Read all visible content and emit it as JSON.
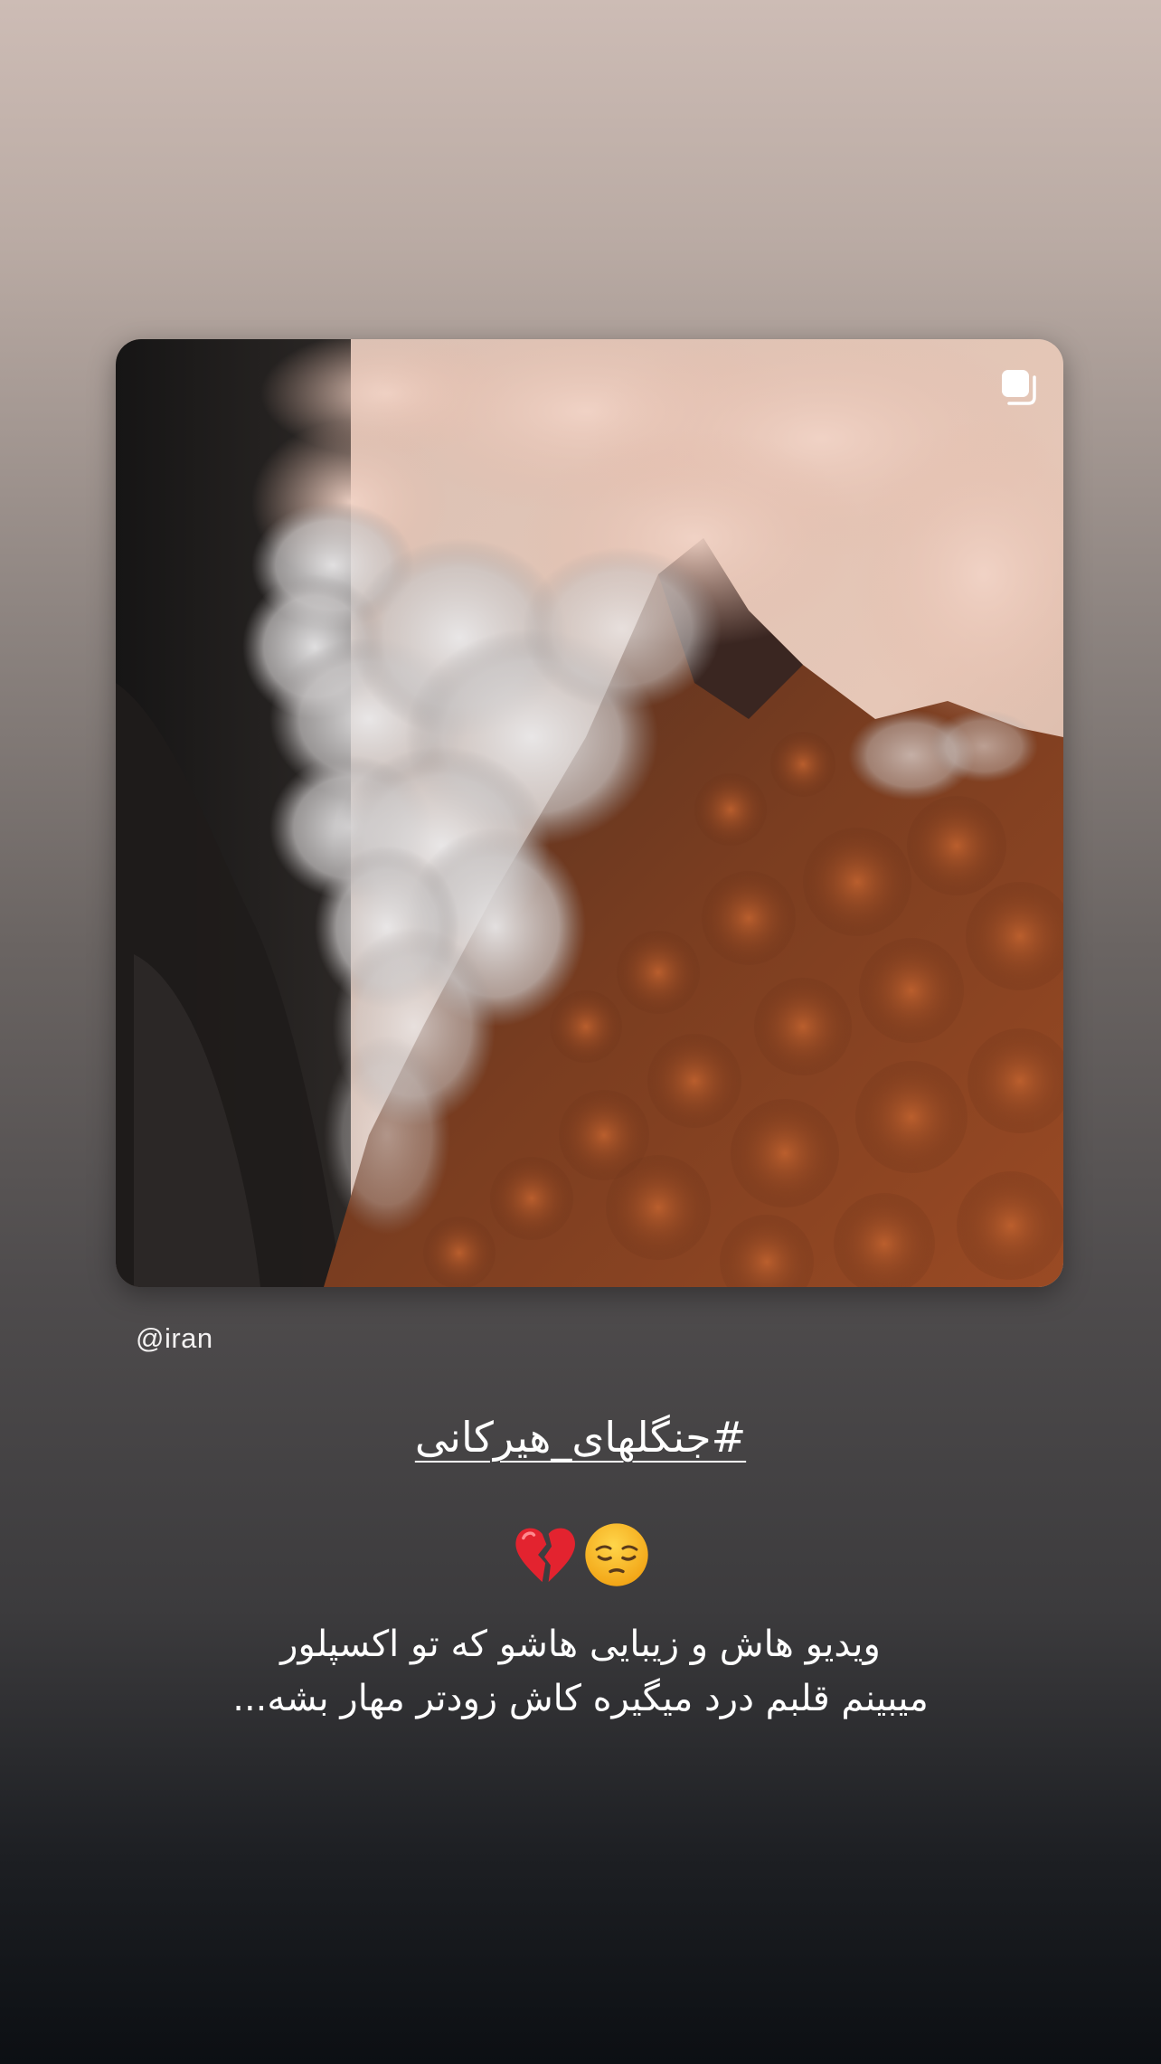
{
  "story": {
    "handle": "@iran",
    "hashtag": "#جنگلهای_هیرکانی",
    "emojis": [
      "pensive-face-emoji",
      "broken-heart-emoji"
    ],
    "caption_lines": [
      "ویدیو هاش و زیبایی هاشو که تو اکسپلور",
      "میبینم قلبم درد میگیره کاش زودتر مهار بشه..."
    ]
  },
  "post": {
    "image_subject": "smoke rising from a burning autumn forest on a mountain ridge",
    "indicator_icon": "multiple-posts-icon"
  },
  "colors": {
    "background_top": "#cdbcb5",
    "background_bottom": "#0c0f13",
    "text": "#ffffff",
    "foliage": "#a9532a",
    "smoke": "#d9d7d8"
  }
}
